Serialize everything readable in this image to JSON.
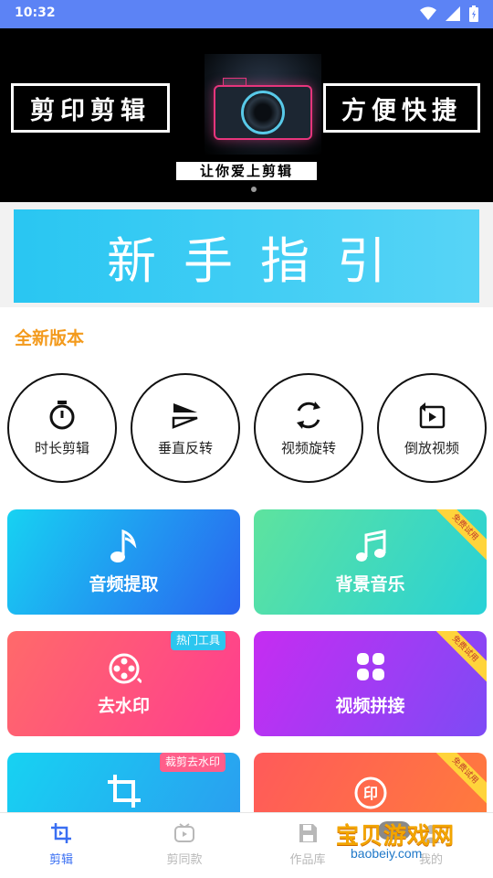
{
  "status": {
    "time": "10:32"
  },
  "banner": {
    "left_text": "剪印剪辑",
    "right_text": "方便快捷",
    "sub_text": "让你爱上剪辑"
  },
  "guide": {
    "text": "新手指引"
  },
  "section_title": "全新版本",
  "tools": [
    {
      "label": "时长剪辑",
      "icon": "stopwatch-icon"
    },
    {
      "label": "垂直反转",
      "icon": "flip-icon"
    },
    {
      "label": "视频旋转",
      "icon": "rotate-icon"
    },
    {
      "label": "倒放视频",
      "icon": "reverse-play-icon"
    }
  ],
  "cards": [
    {
      "label": "音频提取",
      "icon": "music-note-icon",
      "gradient": [
        "#17d2f2",
        "#2a63f0"
      ]
    },
    {
      "label": "背景音乐",
      "icon": "music-notes-icon",
      "gradient": [
        "#5ee39e",
        "#28d1d7"
      ],
      "ribbon": "免费试用"
    },
    {
      "label": "去水印",
      "icon": "film-reel-icon",
      "gradient": [
        "#ff6a6a",
        "#ff3d8f"
      ],
      "tag": "热门工具",
      "tag_color": "#2cc6ef"
    },
    {
      "label": "视频拼接",
      "icon": "grid-icon",
      "gradient": [
        "#c62cf2",
        "#7d4bf5"
      ],
      "ribbon": "免费试用"
    },
    {
      "label": "",
      "icon": "crop-icon",
      "gradient": [
        "#17d2f2",
        "#2a9ff0"
      ],
      "tag": "裁剪去水印",
      "tag_color": "#ff5e8a"
    },
    {
      "label": "",
      "icon": "stamp-icon",
      "gradient": [
        "#ff5a5a",
        "#ff7a3d"
      ],
      "ribbon": "免费试用"
    }
  ],
  "tabs": [
    {
      "label": "剪辑",
      "active": true,
      "icon": "crop-tab-icon"
    },
    {
      "label": "剪同款",
      "active": false,
      "icon": "tv-icon"
    },
    {
      "label": "作品库",
      "active": false,
      "icon": "save-icon"
    },
    {
      "label": "我的",
      "active": false,
      "icon": "user-icon"
    }
  ],
  "watermark": {
    "text": "宝贝游戏网",
    "url": "baobeiy.com"
  },
  "colors": {
    "status_bar": "#5c83f5",
    "accent_orange": "#f39a1c",
    "tab_active": "#3a6ff2",
    "tab_inactive": "#b8b8b8"
  }
}
